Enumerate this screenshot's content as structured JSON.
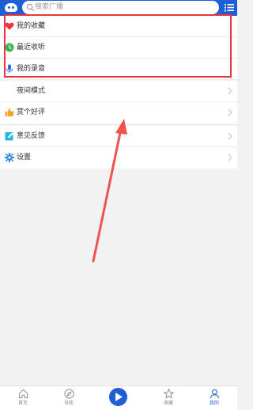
{
  "header": {
    "logo_icon": "radio-logo-icon",
    "search_placeholder": "搜索广播",
    "menu_icon": "list-menu-icon"
  },
  "favorites_section": {
    "items": [
      {
        "label": "我的收藏",
        "icon": "heart-icon",
        "icon_color": "#e8353f"
      },
      {
        "label": "最近收听",
        "icon": "clock-icon",
        "icon_color": "#3ab54a"
      },
      {
        "label": "我的录音",
        "icon": "microphone-icon",
        "icon_color": "#2b6fd6"
      }
    ]
  },
  "settings_section_1": {
    "items": [
      {
        "label": "夜间模式",
        "icon": "moon-icon",
        "icon_color": "#7b4fc9"
      },
      {
        "label": "赏个好评",
        "icon": "thumbs-up-icon",
        "icon_color": "#f5a623"
      }
    ]
  },
  "settings_section_2": {
    "items": [
      {
        "label": "意见反馈",
        "icon": "feedback-edit-icon",
        "icon_color": "#2bb5e6"
      },
      {
        "label": "设置",
        "icon": "gear-icon",
        "icon_color": "#2b8be6"
      }
    ]
  },
  "bottom_nav": {
    "items": [
      {
        "label": "首页",
        "icon": "home-icon",
        "active": false
      },
      {
        "label": "导航",
        "icon": "compass-icon",
        "active": false
      },
      {
        "label": "",
        "icon": "play-icon",
        "active": false
      },
      {
        "label": "收藏",
        "icon": "star-icon",
        "active": false
      },
      {
        "label": "我的",
        "icon": "user-icon",
        "active": true
      }
    ]
  },
  "colors": {
    "brand_blue": "#1e5fd7",
    "annotation_red": "#e8353f",
    "page_background": "#f2f2f2"
  }
}
